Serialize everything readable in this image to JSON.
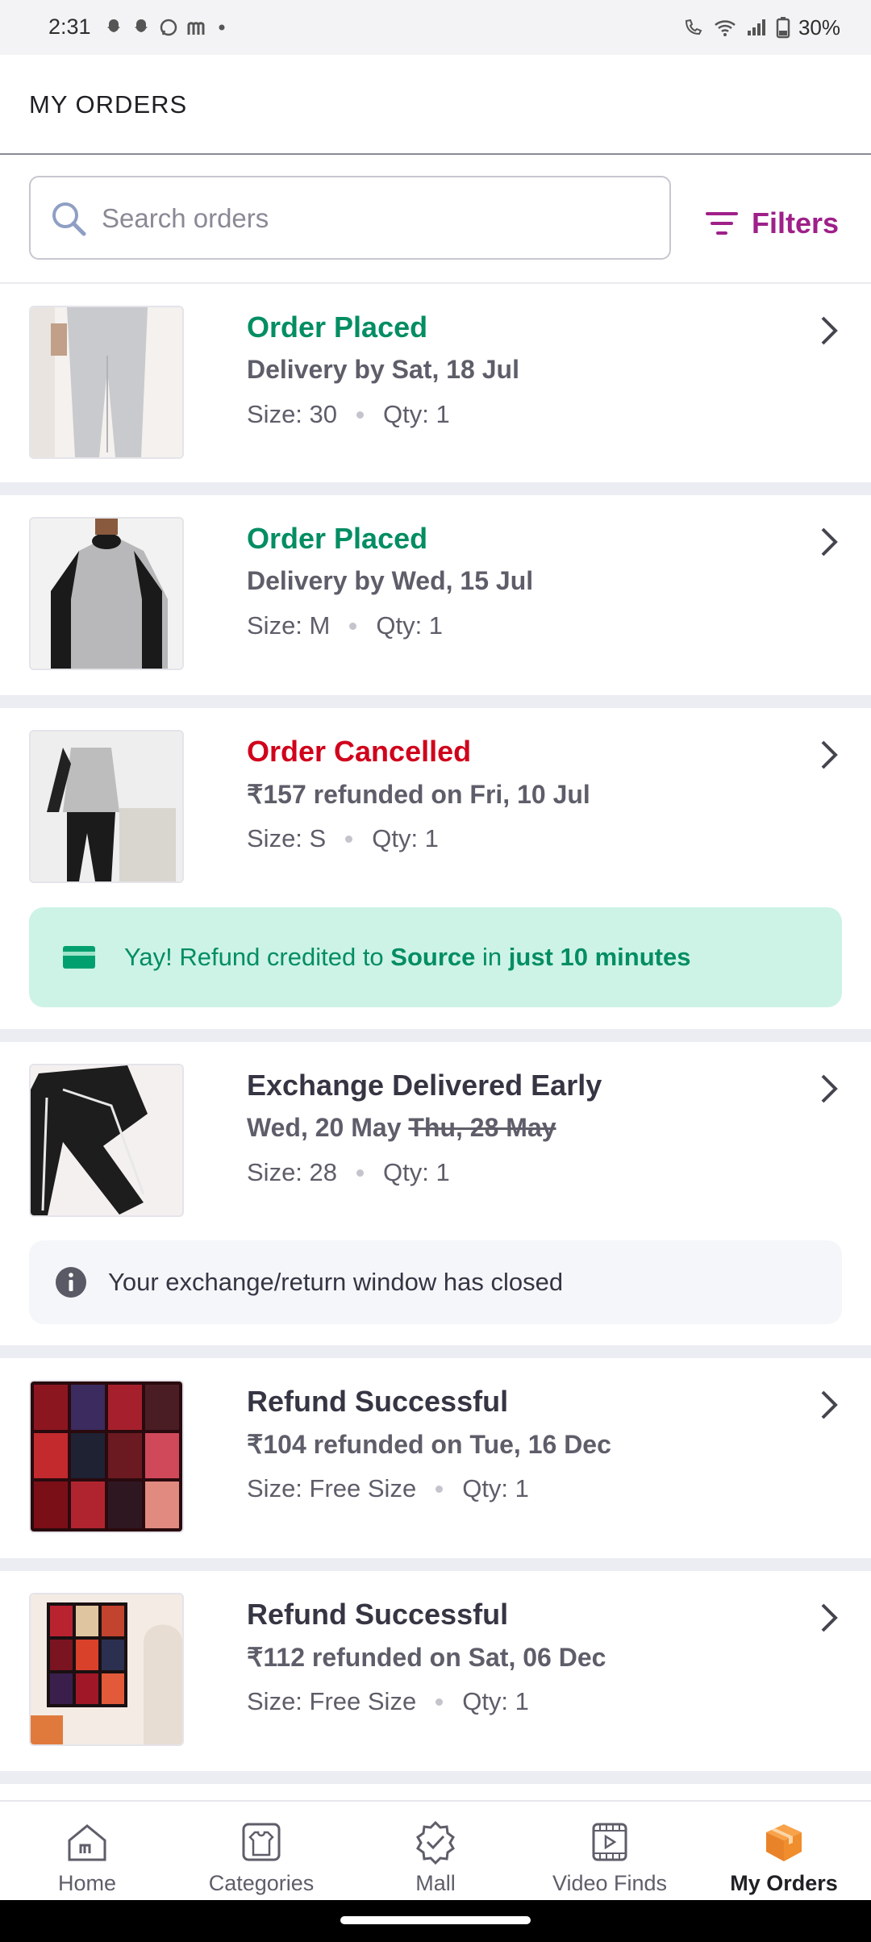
{
  "status_bar": {
    "time": "2:31",
    "battery": "30%"
  },
  "header": {
    "title": "MY ORDERS"
  },
  "search": {
    "placeholder": "Search orders",
    "filters_label": "Filters"
  },
  "orders": [
    {
      "status": "Order Placed",
      "status_color": "#038d63",
      "line2": "Delivery by Sat, 18 Jul",
      "size": "Size: 30",
      "qty": "Qty: 1",
      "thumb": "grey-trousers"
    },
    {
      "status": "Order Placed",
      "status_color": "#038d63",
      "line2": "Delivery by Wed, 15 Jul",
      "size": "Size: M",
      "qty": "Qty: 1",
      "thumb": "raglan-tshirt"
    },
    {
      "status": "Order Cancelled",
      "status_color": "#d0021b",
      "line2": "₹157 refunded on Fri, 10 Jul",
      "size": "Size: S",
      "qty": "Qty: 1",
      "thumb": "grey-black-tshirt",
      "banner": {
        "prefix": "Yay! Refund credited to ",
        "source": "Source",
        "middle": " in ",
        "time": "just 10 minutes"
      }
    },
    {
      "status": "Exchange Delivered Early",
      "status_color": "#353543",
      "line2": "Wed, 20 May",
      "line2_strike": "Thu, 28 May",
      "size": "Size: 28",
      "qty": "Qty: 1",
      "thumb": "black-track-pants",
      "info": "Your exchange/return window has closed"
    },
    {
      "status": "Refund Successful",
      "status_color": "#353543",
      "line2": "₹104 refunded on Tue, 16 Dec",
      "size": "Size: Free Size",
      "qty": "Qty: 1",
      "thumb": "poster-collage"
    },
    {
      "status": "Refund Successful",
      "status_color": "#353543",
      "line2": "₹112 refunded on Sat, 06 Dec",
      "size": "Size: Free Size",
      "qty": "Qty: 1",
      "thumb": "poster-wall"
    }
  ],
  "bottom_nav": [
    {
      "label": "Home",
      "icon": "home-icon"
    },
    {
      "label": "Categories",
      "icon": "categories-icon"
    },
    {
      "label": "Mall",
      "icon": "mall-icon"
    },
    {
      "label": "Video Finds",
      "icon": "video-icon"
    },
    {
      "label": "My Orders",
      "icon": "orders-box-icon",
      "active": true
    }
  ],
  "colors": {
    "accent": "#9f2089",
    "success": "#038d63",
    "danger": "#d0021b",
    "refund_banner_bg": "#cdf3e6"
  }
}
